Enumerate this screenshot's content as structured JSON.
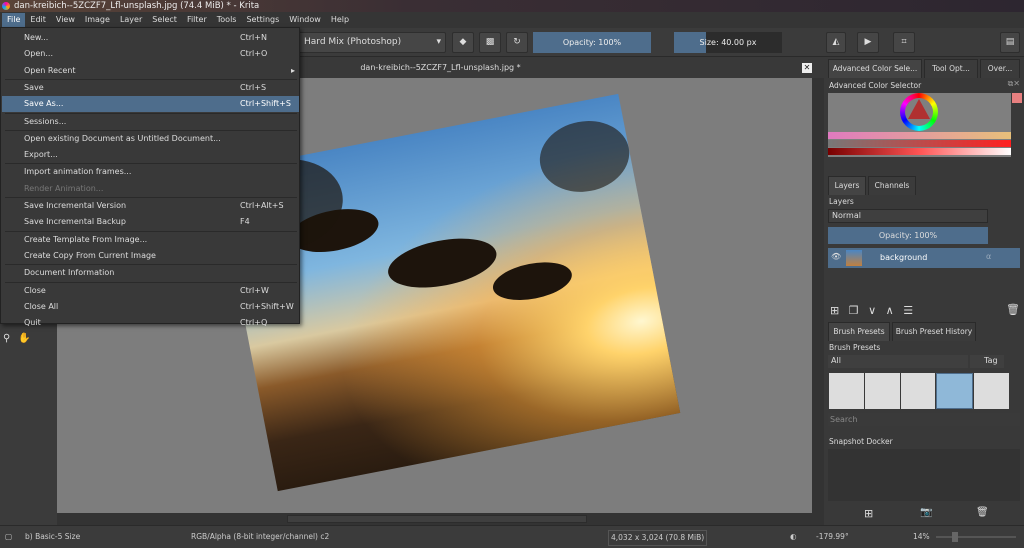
{
  "window": {
    "title": "dan-kreibich--5ZCZF7_Lfl-unsplash.jpg (74.4 MiB)  * - Krita"
  },
  "menubar": [
    "File",
    "Edit",
    "View",
    "Image",
    "Layer",
    "Select",
    "Filter",
    "Tools",
    "Settings",
    "Window",
    "Help"
  ],
  "toolbar": {
    "blend_mode": "Hard Mix (Photoshop)",
    "opacity": "Opacity: 100%",
    "opacity_value": 100,
    "size": "Size: 40.00 px",
    "size_fill_percent": 30
  },
  "document_tab": {
    "title": "dan-kreibich--5ZCZF7_Lfl-unsplash.jpg *"
  },
  "file_menu": [
    {
      "label": "New...",
      "shortcut": "Ctrl+N"
    },
    {
      "label": "Open...",
      "shortcut": "Ctrl+O"
    },
    {
      "label": "Open Recent",
      "shortcut": "",
      "submenu": true
    },
    {
      "label": "Save",
      "shortcut": "Ctrl+S"
    },
    {
      "label": "Save As...",
      "shortcut": "Ctrl+Shift+S",
      "highlighted": true
    },
    {
      "label": "Sessions...",
      "shortcut": ""
    },
    {
      "label": "Open existing Document as Untitled Document...",
      "shortcut": ""
    },
    {
      "label": "Export...",
      "shortcut": ""
    },
    {
      "label": "Import animation frames...",
      "shortcut": ""
    },
    {
      "label": "Render Animation...",
      "shortcut": "",
      "disabled": true
    },
    {
      "label": "Save Incremental Version",
      "shortcut": "Ctrl+Alt+S"
    },
    {
      "label": "Save Incremental Backup",
      "shortcut": "F4"
    },
    {
      "label": "Create Template From Image...",
      "shortcut": ""
    },
    {
      "label": "Create Copy From Current Image",
      "shortcut": ""
    },
    {
      "label": "Document Information",
      "shortcut": ""
    },
    {
      "label": "Close",
      "shortcut": "Ctrl+W"
    },
    {
      "label": "Close All",
      "shortcut": "Ctrl+Shift+W"
    },
    {
      "label": "Quit",
      "shortcut": "Ctrl+Q"
    }
  ],
  "right_panel": {
    "top_tabs": [
      "Advanced Color Sele...",
      "Tool Opt...",
      "Over..."
    ],
    "color_selector_title": "Advanced Color Selector",
    "layer_tabs": [
      "Layers",
      "Channels"
    ],
    "layers_title": "Layers",
    "blend": "Normal",
    "opacity": "Opacity:  100%",
    "layer_name": "background",
    "brush_tabs": [
      "Brush Presets",
      "Brush Preset History"
    ],
    "brush_title": "Brush Presets",
    "brush_filter": "All",
    "tag": "Tag",
    "search_placeholder": "Search",
    "snapshot_title": "Snapshot Docker"
  },
  "status": {
    "brush": "b) Basic-5 Size",
    "color_model": "RGB/Alpha (8-bit integer/channel)  c2",
    "dimensions": "4,032 x 3,024 (70.8 MiB)",
    "rotation": "-179.99°",
    "zoom": "14%"
  },
  "colors": {
    "accent": "#4e6d8c",
    "fg_color": "#e88080"
  }
}
